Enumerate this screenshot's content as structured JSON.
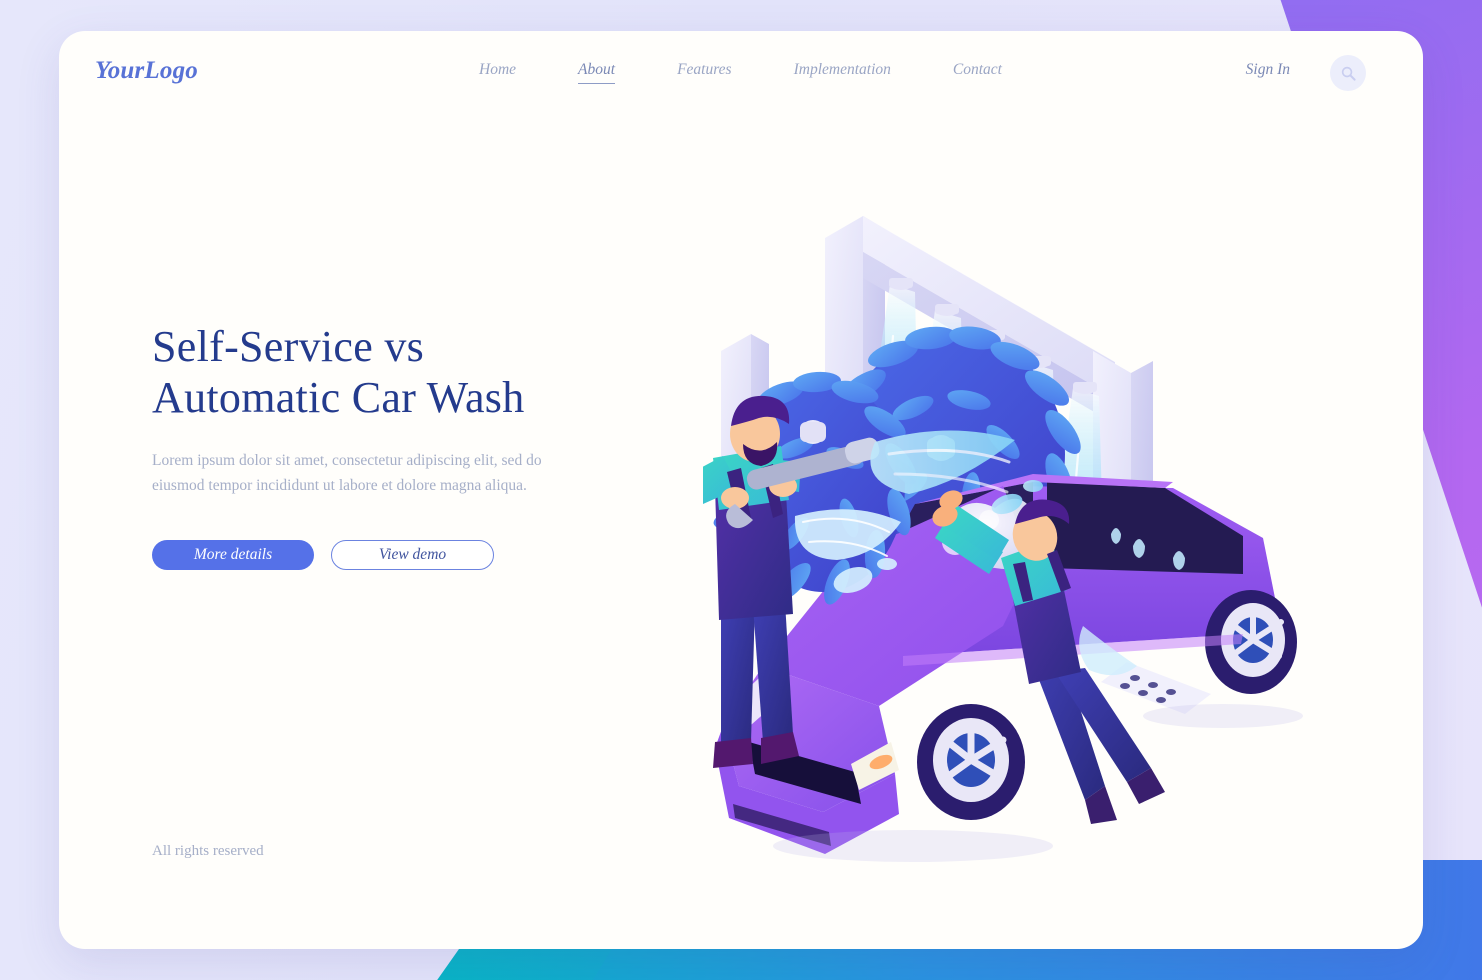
{
  "brand": {
    "logo": "YourLogo"
  },
  "nav": {
    "items": [
      {
        "label": "Home",
        "active": false
      },
      {
        "label": "About",
        "active": true
      },
      {
        "label": "Features",
        "active": false
      },
      {
        "label": "Implementation",
        "active": false
      },
      {
        "label": "Contact",
        "active": false
      }
    ],
    "sign_in": "Sign In",
    "search_icon": "search-icon"
  },
  "hero": {
    "title_line1": "Self-Service vs",
    "title_line2": "Automatic Car Wash",
    "paragraph": "Lorem ipsum dolor sit amet, consectetur adipiscing elit, sed do eiusmod tempor incididunt ut labore et dolore magna aliqua.",
    "primary_button": "More details",
    "secondary_button": "View demo"
  },
  "footer": {
    "rights": "All rights reserved"
  },
  "illustration": {
    "name": "isometric-automatic-car-wash-with-two-workers",
    "elements": [
      "car-wash-gantry-frame",
      "water-spray-nozzles",
      "rotating-blue-brush-left",
      "rotating-blue-brush-right",
      "purple-car",
      "worker-with-pressure-washer",
      "worker-with-sponge",
      "foam-suds",
      "floor-drain-grate"
    ]
  },
  "colors": {
    "page_background": "#e2e3fa",
    "card_background": "#fffefb",
    "heading": "#243b8d",
    "body_text": "#a6afc8",
    "nav_link": "#9aa5c4",
    "nav_active": "#7b89b5",
    "logo": "#5872d6",
    "primary_button_bg": "#5571e8",
    "secondary_button_border": "#6b83e0",
    "corner_top_right_gradient": "#b565f0",
    "corner_bottom_gradient_start": "#03bfb6",
    "corner_bottom_gradient_end": "#4178e8",
    "car_body": "#9b5ef0",
    "brush": "#4a5fe0"
  }
}
